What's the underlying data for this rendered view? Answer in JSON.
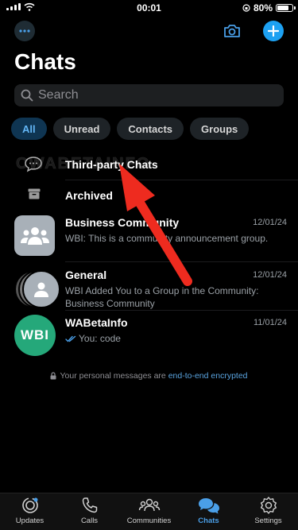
{
  "status_bar": {
    "time": "00:01",
    "battery": "80%",
    "battery_level": 0.8
  },
  "header": {
    "title": "Chats",
    "more_icon": "ellipsis-circle-icon",
    "camera_icon": "camera-icon",
    "add_icon": "plus-circle-icon"
  },
  "search": {
    "placeholder": "Search"
  },
  "filters": [
    {
      "label": "All",
      "active": true
    },
    {
      "label": "Unread",
      "active": false
    },
    {
      "label": "Contacts",
      "active": false
    },
    {
      "label": "Groups",
      "active": false
    }
  ],
  "third_party": {
    "label": "Third-party Chats",
    "icon": "chat-bubbles-icon"
  },
  "archived": {
    "label": "Archived",
    "icon": "archive-box-icon"
  },
  "watermark": "CWABETAINFO",
  "chats": [
    {
      "name": "Business Community",
      "date": "12/01/24",
      "message": "WBI: This is a community announcement group."
    },
    {
      "name": "General",
      "date": "12/01/24",
      "message": "WBI Added You to a Group in the Community: Business Community"
    },
    {
      "name": "WABetaInfo",
      "date": "11/01/24",
      "message": "You: code",
      "avatar_text": "WBI"
    }
  ],
  "encryption": {
    "prefix": "Your personal messages are ",
    "link": "end-to-end encrypted"
  },
  "tabs": [
    {
      "label": "Updates",
      "icon": "updates-icon",
      "active": false
    },
    {
      "label": "Calls",
      "icon": "phone-icon",
      "active": false
    },
    {
      "label": "Communities",
      "icon": "communities-icon",
      "active": false
    },
    {
      "label": "Chats",
      "icon": "chats-icon",
      "active": true
    },
    {
      "label": "Settings",
      "icon": "settings-icon",
      "active": false
    }
  ],
  "colors": {
    "accent": "#1da1f2",
    "active_chip_bg": "#0f3552",
    "active_chip_text": "#63b6f5",
    "arrow": "#ee2b1f",
    "wbi_avatar": "#25a87a",
    "community_avatar": "#a8b0b8"
  }
}
